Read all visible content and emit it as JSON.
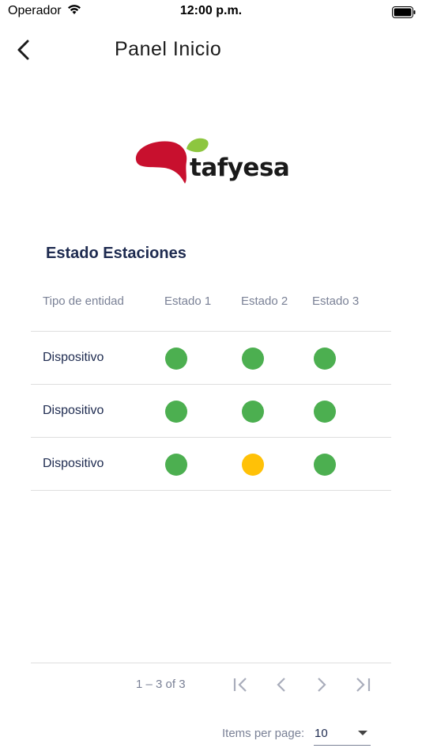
{
  "status_bar": {
    "carrier": "Operador",
    "time": "12:00 p.m."
  },
  "nav": {
    "title": "Panel Inicio",
    "back_icon": "chevron-left-icon"
  },
  "logo": {
    "word": "tafyesa",
    "red": "#c8102e",
    "green": "#8dc63f"
  },
  "section": {
    "title": "Estado Estaciones"
  },
  "table": {
    "headers": [
      "Tipo de entidad",
      "Estado 1",
      "Estado 2",
      "Estado 3"
    ],
    "rows": [
      {
        "tipo": "Dispositivo",
        "estados": [
          "ok",
          "ok",
          "ok"
        ]
      },
      {
        "tipo": "Dispositivo",
        "estados": [
          "ok",
          "ok",
          "ok"
        ]
      },
      {
        "tipo": "Dispositivo",
        "estados": [
          "ok",
          "warning",
          "ok"
        ]
      }
    ],
    "status_colors": {
      "ok": "#4caf50",
      "warning": "#ffc107"
    }
  },
  "paginator": {
    "range": "1 – 3 of 3",
    "items_per_page_label": "Items per page:",
    "page_size": "10",
    "icons": [
      "first-page-icon",
      "previous-page-icon",
      "next-page-icon",
      "last-page-icon"
    ]
  }
}
